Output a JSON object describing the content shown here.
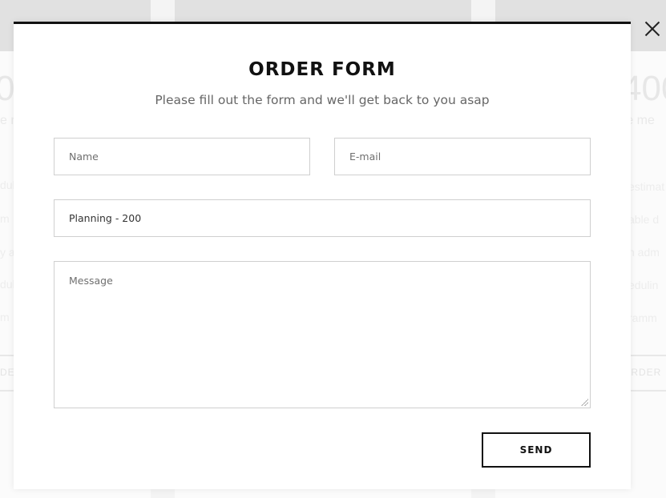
{
  "form": {
    "title": "ORDER FORM",
    "subtitle": "Please fill out the form and we'll get back to you asap",
    "name_placeholder": "Name",
    "email_placeholder": "E-mail",
    "service_value": "Planning - 200",
    "message_placeholder": "Message",
    "send_label": "SEND"
  },
  "background": {
    "left_price": "0",
    "right_price": "400",
    "left_sub": "e m",
    "right_sub": "re me",
    "left_features": [
      "dul",
      "m",
      "y a",
      "dul",
      "m"
    ],
    "right_features": [
      "estimat",
      "able d",
      "n adm",
      "edulin",
      "ramm"
    ],
    "left_order": "DE",
    "right_order": "ORDER"
  },
  "colors": {
    "modal_border": "#111111",
    "field_border": "#cfcfcf",
    "subtitle": "#666666"
  }
}
